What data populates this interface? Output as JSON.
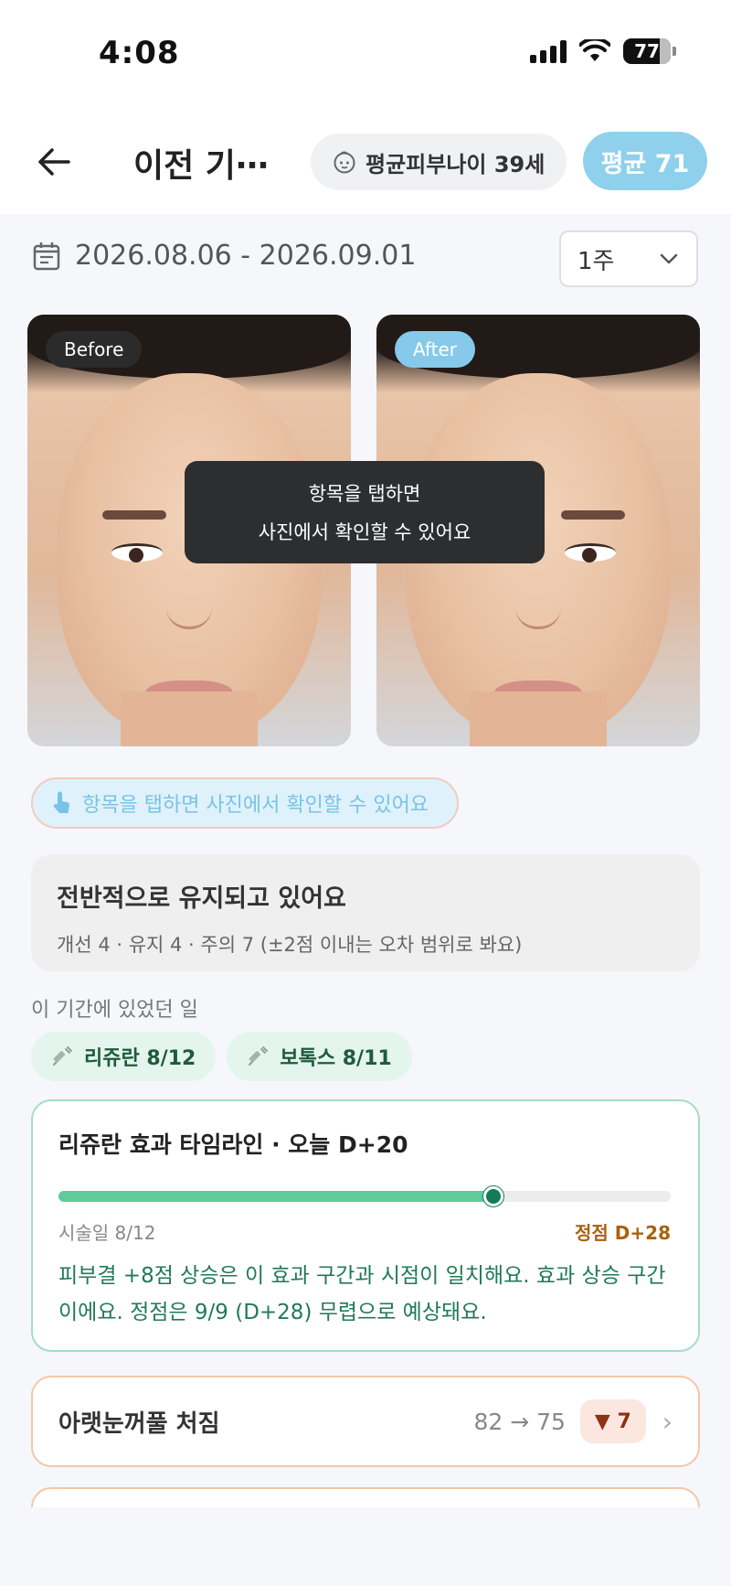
{
  "status_bar": {
    "time": "4:08",
    "battery": "77"
  },
  "header": {
    "title": "이전 기⋯",
    "age_chip": "평균피부나이 39세",
    "average_pill": "평균 71"
  },
  "date_range": "2026.08.06 - 2026.09.01",
  "period_select": {
    "value": "1주"
  },
  "photos": {
    "before_label": "Before",
    "after_label": "After"
  },
  "tooltip": {
    "line1": "항목을 탭하면",
    "line2": "사진에서 확인할 수 있어요"
  },
  "tap_hint": "항목을 탭하면 사진에서 확인할 수 있어요",
  "summary": {
    "title": "전반적으로 유지되고 있어요",
    "subtitle": "개선 4 · 유지 4 · 주의 7 (±2점 이내는 오차 범위로 봐요)"
  },
  "events": {
    "heading": "이 기간에 있었던 일",
    "chips": [
      {
        "label": "리쥬란 8/12"
      },
      {
        "label": "보톡스 8/11"
      }
    ]
  },
  "timeline": {
    "title": "리쥬란 효과 타임라인 · 오늘 D+20",
    "progress": 0.71,
    "start_label": "시술일 8/12",
    "peak_label": "정점 D+28",
    "description": "피부결 +8점 상승은 이 효과 구간과 시점이 일치해요. 효과 상승 구간이에요. 정점은 9/9 (D+28) 무렵으로 예상돼요."
  },
  "metric": {
    "name": "아랫눈꺼풀 처짐",
    "values": "82 → 75",
    "badge": "▼ 7"
  },
  "colors": {
    "accent_blue": "#8fd0ec",
    "green": "#5fcb9a",
    "dark_green": "#147a58",
    "warn_orange": "#f4c7a8"
  }
}
